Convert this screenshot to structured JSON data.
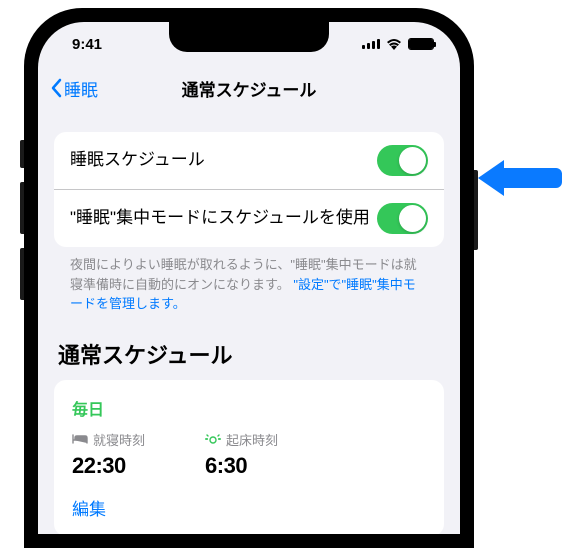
{
  "status": {
    "time": "9:41"
  },
  "nav": {
    "back": "睡眠",
    "title": "通常スケジュール"
  },
  "toggles": {
    "sleep_schedule": {
      "label": "睡眠スケジュール",
      "on": true
    },
    "focus_mode": {
      "label": "\"睡眠\"集中モードにスケジュールを使用",
      "on": true
    }
  },
  "footer": {
    "text": "夜間によりよい睡眠が取れるように、\"睡眠\"集中モードは就寝準備時に自動的にオンになります。",
    "link": "\"設定\"で\"睡眠\"集中モードを管理します。"
  },
  "section_title": "通常スケジュール",
  "schedule": {
    "days": "毎日",
    "bedtime_label": "就寝時刻",
    "bedtime": "22:30",
    "wake_label": "起床時刻",
    "wake": "6:30",
    "edit": "編集"
  }
}
